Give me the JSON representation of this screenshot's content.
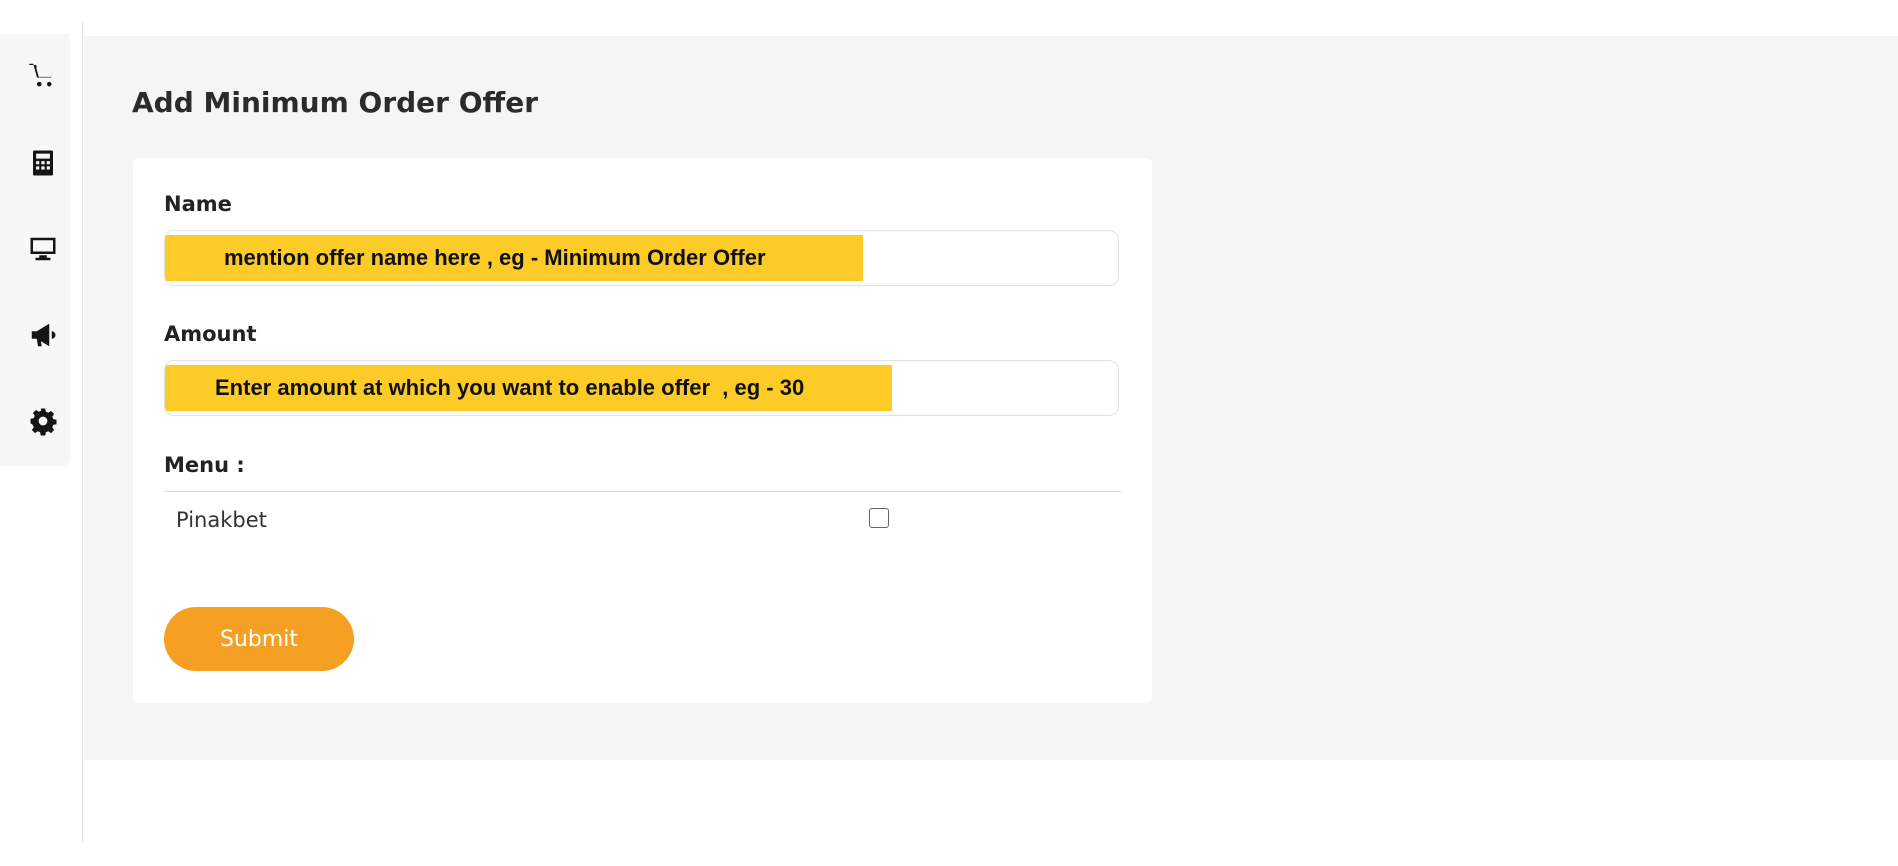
{
  "sidebar": {
    "items": [
      {
        "icon": "cart-icon"
      },
      {
        "icon": "calculator-icon"
      },
      {
        "icon": "monitor-icon"
      },
      {
        "icon": "megaphone-icon"
      },
      {
        "icon": "gear-icon"
      }
    ]
  },
  "page": {
    "title": "Add Minimum Order Offer"
  },
  "form": {
    "name_label": "Name",
    "name_hint": "mention offer name here , eg - Minimum Order Offer",
    "amount_label": "Amount",
    "amount_hint": "Enter amount at which you want to enable offer  , eg - 30",
    "menu_label": "Menu :",
    "menu_items": [
      {
        "label": "Pinakbet",
        "checked": false
      }
    ],
    "submit_label": "Submit"
  },
  "colors": {
    "accent": "#f6a023",
    "highlight": "#fccb28",
    "background": "#f5f5f5"
  }
}
